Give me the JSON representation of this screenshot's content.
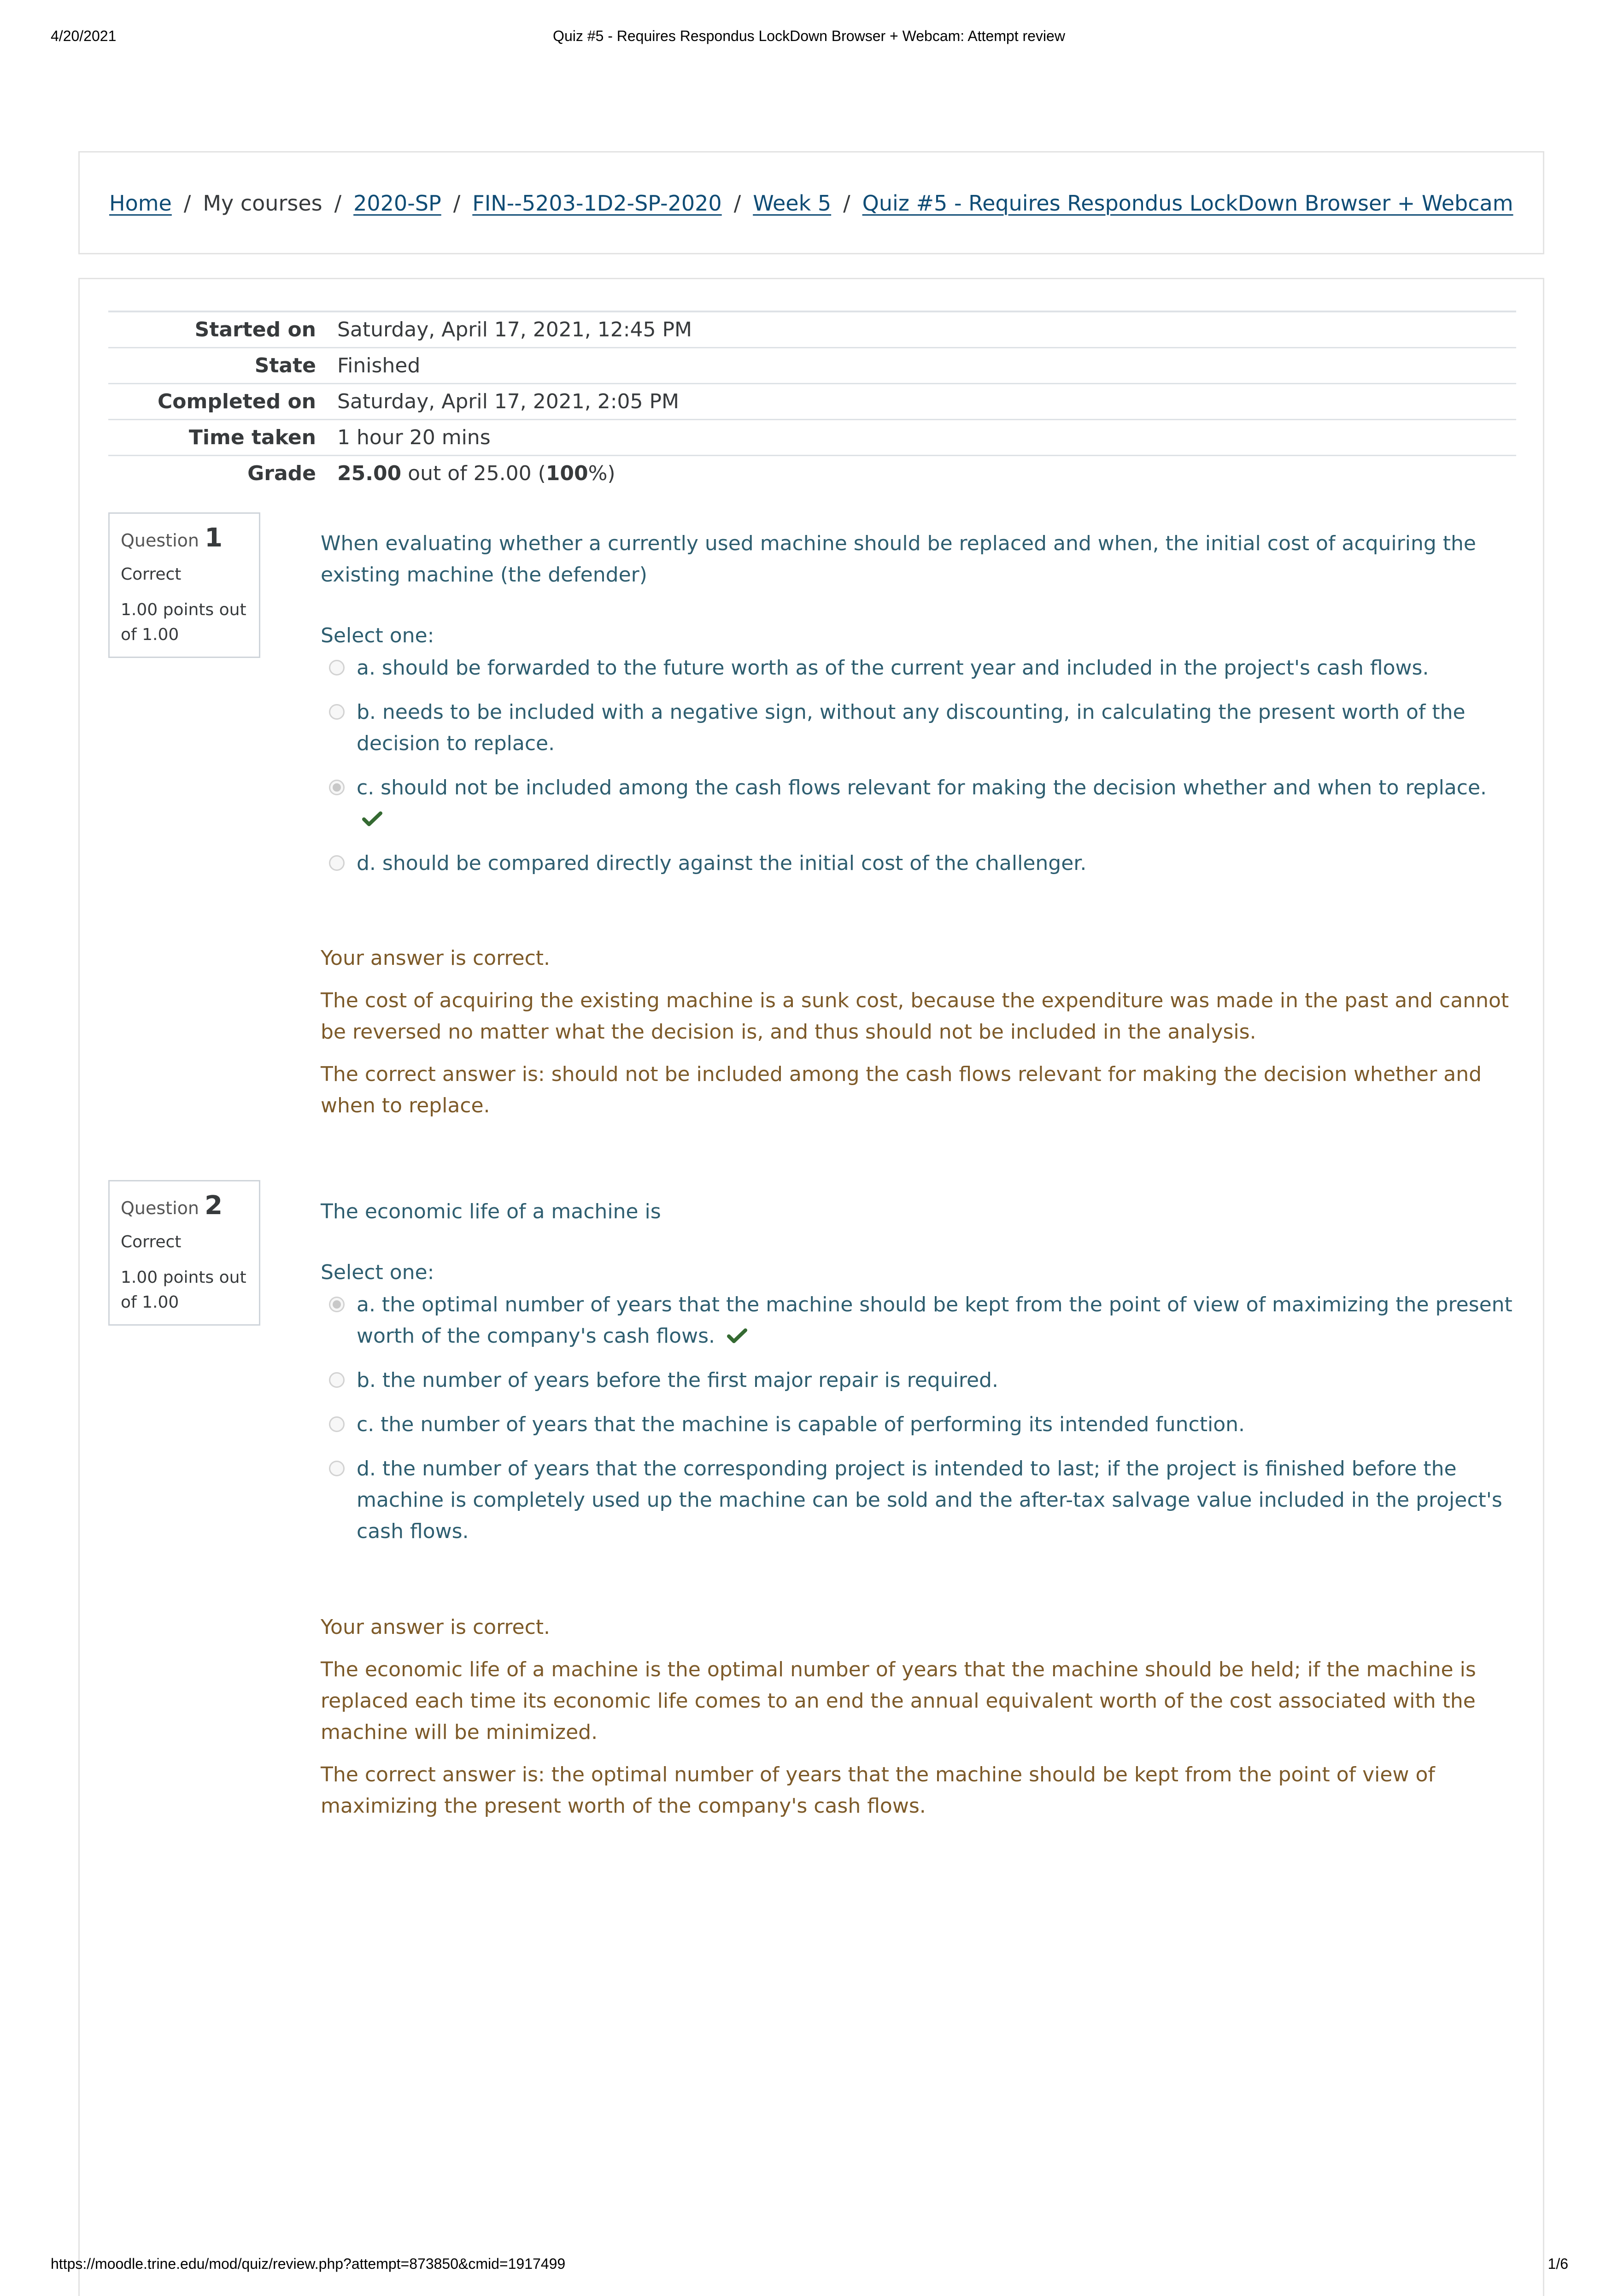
{
  "print_header": {
    "date": "4/20/2021",
    "title": "Quiz #5 - Requires Respondus LockDown Browser + Webcam: Attempt review"
  },
  "breadcrumb": {
    "items": [
      {
        "label": "Home",
        "link": true
      },
      {
        "label": "My courses",
        "link": false
      },
      {
        "label": "2020-SP",
        "link": true
      },
      {
        "label": "FIN--5203-1D2-SP-2020",
        "link": true
      },
      {
        "label": "Week 5",
        "link": true
      },
      {
        "label": "Quiz #5 - Requires Respondus LockDown Browser + Webcam",
        "link": true
      }
    ],
    "separator": "/"
  },
  "summary": {
    "started_on_label": "Started on",
    "started_on": "Saturday, April 17, 2021, 12:45 PM",
    "state_label": "State",
    "state": "Finished",
    "completed_on_label": "Completed on",
    "completed_on": "Saturday, April 17, 2021, 2:05 PM",
    "time_taken_label": "Time taken",
    "time_taken": "1 hour 20 mins",
    "grade_label": "Grade",
    "grade_score": "25.00",
    "grade_out_of_text": " out of 25.00 (",
    "grade_percent": "100",
    "grade_suffix": "%)"
  },
  "questions": [
    {
      "label": "Question",
      "number": "1",
      "state": "Correct",
      "grade": "1.00 points out of 1.00",
      "text": "When evaluating whether a currently used machine should be replaced and when, the initial cost of acquiring the existing machine (the defender)",
      "prompt": "Select one:",
      "answers": [
        {
          "text": "a. should be forwarded to the future worth as of the current year and included in the project's cash flows.",
          "selected": false,
          "correct_mark": false
        },
        {
          "text": "b. needs to be included with a negative sign, without any discounting, in calculating the present worth of the decision to replace.",
          "selected": false,
          "correct_mark": false
        },
        {
          "text": "c. should not be included among the cash flows relevant for making the decision whether and when to replace.",
          "selected": true,
          "correct_mark": true
        },
        {
          "text": "d. should be compared directly against the initial cost of the challenger.",
          "selected": false,
          "correct_mark": false
        }
      ],
      "feedback": {
        "status": "Your answer is correct.",
        "general": "The cost of acquiring the existing machine is a sunk cost, because the expenditure was made in the past and cannot be reversed no matter what the decision is, and thus should not be included in the analysis.",
        "right_answer": "The correct answer is: should not be included among the cash flows relevant for making the decision whether and when to replace."
      }
    },
    {
      "label": "Question",
      "number": "2",
      "state": "Correct",
      "grade": "1.00 points out of 1.00",
      "text": "The economic life of a machine is",
      "prompt": "Select one:",
      "answers": [
        {
          "text": "a. the optimal number of years that the machine should be kept from the point of view of maximizing the present worth of the company's cash flows.",
          "selected": true,
          "correct_mark": true
        },
        {
          "text": "b. the number of years before the first major repair is required.",
          "selected": false,
          "correct_mark": false
        },
        {
          "text": "c. the number of years that the machine is capable of performing its intended function.",
          "selected": false,
          "correct_mark": false
        },
        {
          "text": "d. the number of years that the corresponding project is intended to last; if the project is finished before the machine is completely used up the machine can be sold and the after-tax salvage value included in the project's cash flows.",
          "selected": false,
          "correct_mark": false
        }
      ],
      "feedback": {
        "status": "Your answer is correct.",
        "general": "The economic life of a machine is the optimal number of years that the machine should be held; if the machine is replaced each time its economic life comes to an end the annual equivalent worth of the cost associated with the machine will be minimized.",
        "right_answer": "The correct answer is: the optimal number of years that the machine should be kept from the point of view of maximizing the present worth of the company's cash flows."
      }
    }
  ],
  "print_footer": {
    "url": "https://moodle.trine.edu/mod/quiz/review.php?attempt=873850&cmid=1917499",
    "page": "1/6"
  },
  "colors": {
    "link": "#0f4c75",
    "question_text": "#2e5e70",
    "feedback_text": "#7d5a29",
    "correct_check": "#356a32"
  }
}
